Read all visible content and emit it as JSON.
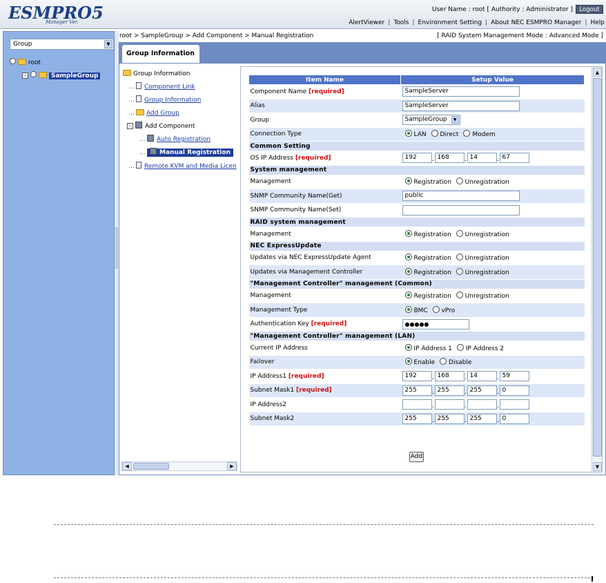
{
  "header": {
    "logo_main": "ESMPRO5",
    "logo_sub": "Manager Ver.",
    "user_info": "User Name : root  [ Authority : Administrator ]",
    "logout_label": "Logout",
    "menu": [
      "AlertViewer",
      "Tools",
      "Environment Setting",
      "About NEC ESMPRO Manager",
      "Help"
    ]
  },
  "sidebar": {
    "group_select_value": "Group",
    "tree_root": "root",
    "tree_child": "SampleGroup"
  },
  "content": {
    "breadcrumb": "root > SampleGroup > Add Component > Manual Registration",
    "mode": "[ RAID System Management Mode : Advanced Mode ]",
    "tab_label": "Group Information"
  },
  "nav": {
    "root": "Group Information",
    "component_link": "Component Link",
    "group_information": "Group Information",
    "add_group": "Add Group",
    "add_component": "Add Component",
    "auto_registration": "Auto Registration",
    "manual_registration": "Manual Registration",
    "remote_kvm": "Remote KVM and Media Licen"
  },
  "form": {
    "col_item": "Item Name",
    "col_value": "Setup Value",
    "required": "[required]",
    "component_name_label": "Component Name",
    "component_name_value": "SampleServer",
    "alias_label": "Alias",
    "alias_value": "SampleServer",
    "group_label": "Group",
    "group_value": "SampleGroup",
    "connection_type_label": "Connection Type",
    "connection_options": [
      "LAN",
      "Direct",
      "Modem"
    ],
    "common_setting": "Common Setting",
    "os_ip_label": "OS IP Address",
    "os_ip": [
      "192",
      "168",
      "14",
      "67"
    ],
    "system_mgmt": "System management",
    "management_label": "Management",
    "reg_options": [
      "Registration",
      "Unregistration"
    ],
    "snmp_get_label": "SNMP Community Name(Get)",
    "snmp_get_value": "public",
    "snmp_set_label": "SNMP Community Name(Set)",
    "raid_mgmt": "RAID system management",
    "nec_update": "NEC ExpressUpdate",
    "updates_agent_label": "Updates via NEC ExpressUpdate Agent",
    "updates_mc_label": "Updates via Management Controller",
    "mc_common": "\"Management Controller\" management (Common)",
    "mgmt_type_label": "Management Type",
    "mgmt_type_options": [
      "BMC",
      "vPro"
    ],
    "auth_key_label": "Authentication Key",
    "auth_key_value": "●●●●●",
    "mc_lan": "\"Management Controller\" management (LAN)",
    "current_ip_label": "Current IP Address",
    "current_ip_options": [
      "IP Address 1",
      "IP Address 2"
    ],
    "failover_label": "Failover",
    "failover_options": [
      "Enable",
      "Disable"
    ],
    "ip1_label": "IP Address1",
    "ip1": [
      "192",
      "168",
      "14",
      "59"
    ],
    "mask1_label": "Subnet Mask1",
    "mask1": [
      "255",
      "255",
      "255",
      "0"
    ],
    "ip2_label": "IP Address2",
    "mask2_label": "Subnet Mask2",
    "mask2": [
      "255",
      "255",
      "255",
      "0"
    ],
    "add_label": "Add"
  }
}
